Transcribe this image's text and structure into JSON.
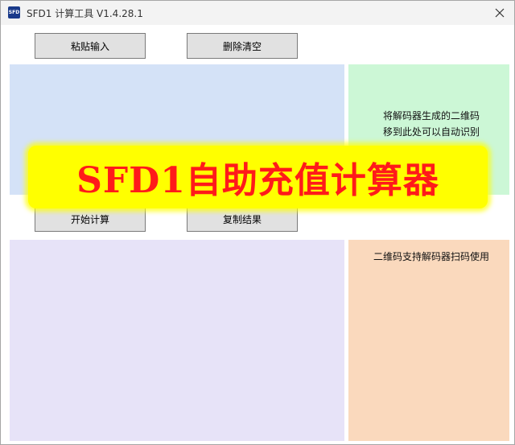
{
  "window": {
    "icon_text": "SFD",
    "title": "SFD1 计算工具 V1.4.28.1"
  },
  "toolbar_top": {
    "paste_label": "粘贴输入",
    "clear_label": "删除清空"
  },
  "toolbar_mid": {
    "start_label": "开始计算",
    "copy_label": "复制结果"
  },
  "qr_drop_panel": {
    "line1": "将解码器生成的二维码",
    "line2": "移到此处可以自动识别"
  },
  "qr_info_panel": {
    "text": "二维码支持解码器扫码使用"
  },
  "banner": {
    "text": "SFD1自助充值计算器"
  },
  "colors": {
    "input_area": "#d4e2f7",
    "drop_panel": "#ccf7d6",
    "output_area": "#e7e3f8",
    "info_panel": "#fad9bd",
    "banner_bg": "#ffff00",
    "banner_text": "#ff1a1a"
  }
}
